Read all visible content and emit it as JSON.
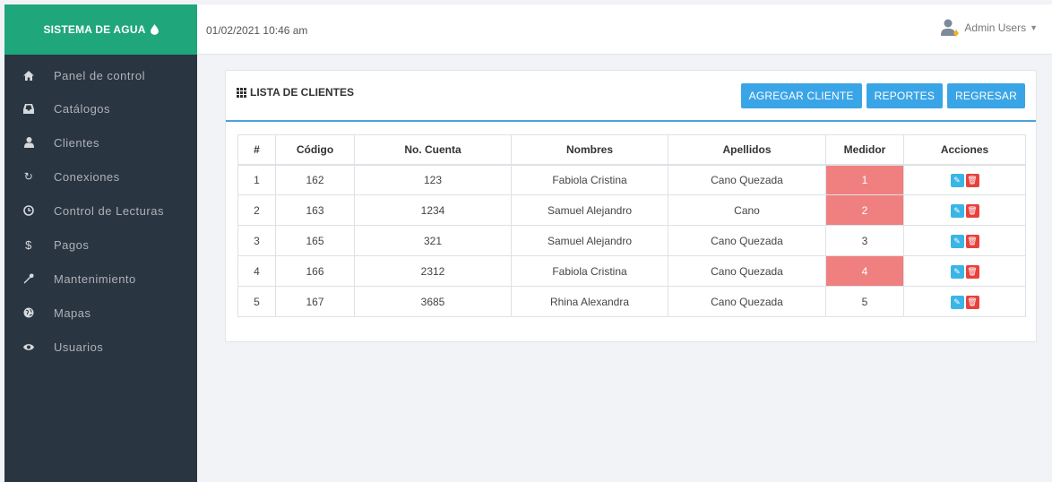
{
  "brand": {
    "title": "SISTEMA DE AGUA"
  },
  "header": {
    "datetime": "01/02/2021 10:46 am",
    "user_name": "Admin Users"
  },
  "sidebar": {
    "items": [
      {
        "label": "Panel de control",
        "icon": "home-icon"
      },
      {
        "label": "Catálogos",
        "icon": "inbox-icon"
      },
      {
        "label": "Clientes",
        "icon": "user-icon"
      },
      {
        "label": "Conexiones",
        "icon": "refresh-icon"
      },
      {
        "label": "Control de Lecturas",
        "icon": "clock-icon"
      },
      {
        "label": "Pagos",
        "icon": "dollar-icon"
      },
      {
        "label": "Mantenimiento",
        "icon": "wrench-icon"
      },
      {
        "label": "Mapas",
        "icon": "globe-icon"
      },
      {
        "label": "Usuarios",
        "icon": "eye-icon"
      }
    ]
  },
  "panel": {
    "title": "LISTA DE CLIENTES",
    "buttons": {
      "add": "AGREGAR CLIENTE",
      "reports": "REPORTES",
      "back": "REGRESAR"
    }
  },
  "table": {
    "headers": [
      "#",
      "Código",
      "No. Cuenta",
      "Nombres",
      "Apellidos",
      "Medidor",
      "Acciones"
    ],
    "rows": [
      {
        "n": "1",
        "codigo": "162",
        "cuenta": "123",
        "nombres": "Fabiola Cristina",
        "apellidos": "Cano Quezada",
        "medidor": "1",
        "highlight": true
      },
      {
        "n": "2",
        "codigo": "163",
        "cuenta": "1234",
        "nombres": "Samuel Alejandro",
        "apellidos": "Cano",
        "medidor": "2",
        "highlight": true
      },
      {
        "n": "3",
        "codigo": "165",
        "cuenta": "321",
        "nombres": "Samuel Alejandro",
        "apellidos": "Cano Quezada",
        "medidor": "3",
        "highlight": false
      },
      {
        "n": "4",
        "codigo": "166",
        "cuenta": "2312",
        "nombres": "Fabiola Cristina",
        "apellidos": "Cano Quezada",
        "medidor": "4",
        "highlight": true
      },
      {
        "n": "5",
        "codigo": "167",
        "cuenta": "3685",
        "nombres": "Rhina Alexandra",
        "apellidos": "Cano Quezada",
        "medidor": "5",
        "highlight": false
      }
    ]
  },
  "colors": {
    "brand": "#1fa67a",
    "sidebar": "#2a3542",
    "button": "#3aa5e6",
    "highlight": "#f08080",
    "edit": "#3ab5e6",
    "delete": "#e8413b"
  }
}
